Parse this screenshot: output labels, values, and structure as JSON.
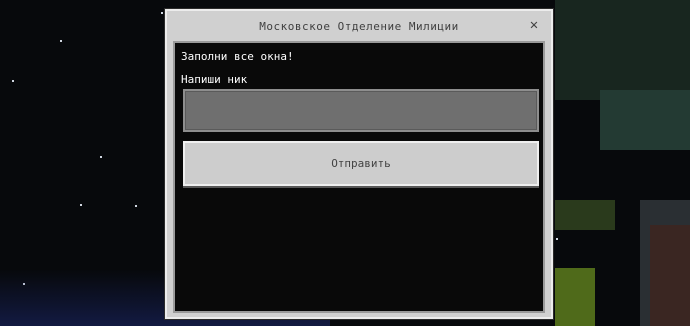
{
  "dialog": {
    "title": "Московское Отделение Милиции",
    "close_label": "✕",
    "message": "Заполни все окна!",
    "field_label": "Напиши ник",
    "field_value": "",
    "submit_label": "Отправить"
  }
}
